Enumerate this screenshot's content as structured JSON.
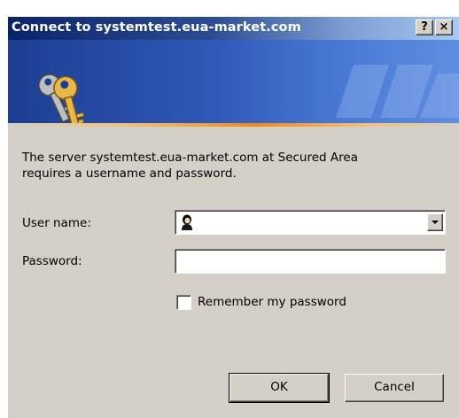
{
  "window": {
    "title": "Connect to systemtest.eua-market.com",
    "help_label": "?",
    "close_label": "×"
  },
  "icons": {
    "banner": "keys-icon",
    "user_field": "user-icon",
    "dropdown": "chevron-down-icon"
  },
  "message": {
    "line1": "The server systemtest.eua-market.com at Secured Area",
    "line2": "requires a username and password."
  },
  "form": {
    "username_label": "User name:",
    "username_value": "",
    "password_label": "Password:",
    "password_value": "",
    "remember_label": "Remember my password",
    "remember_checked": false
  },
  "buttons": {
    "ok": "OK",
    "cancel": "Cancel"
  },
  "colors": {
    "title_bar_start": "#0a246a",
    "title_bar_end": "#a6caf0",
    "dialog_face": "#d4d0c8",
    "banner_blue": "#2f58b8",
    "banner_accent": "#f08a16"
  }
}
